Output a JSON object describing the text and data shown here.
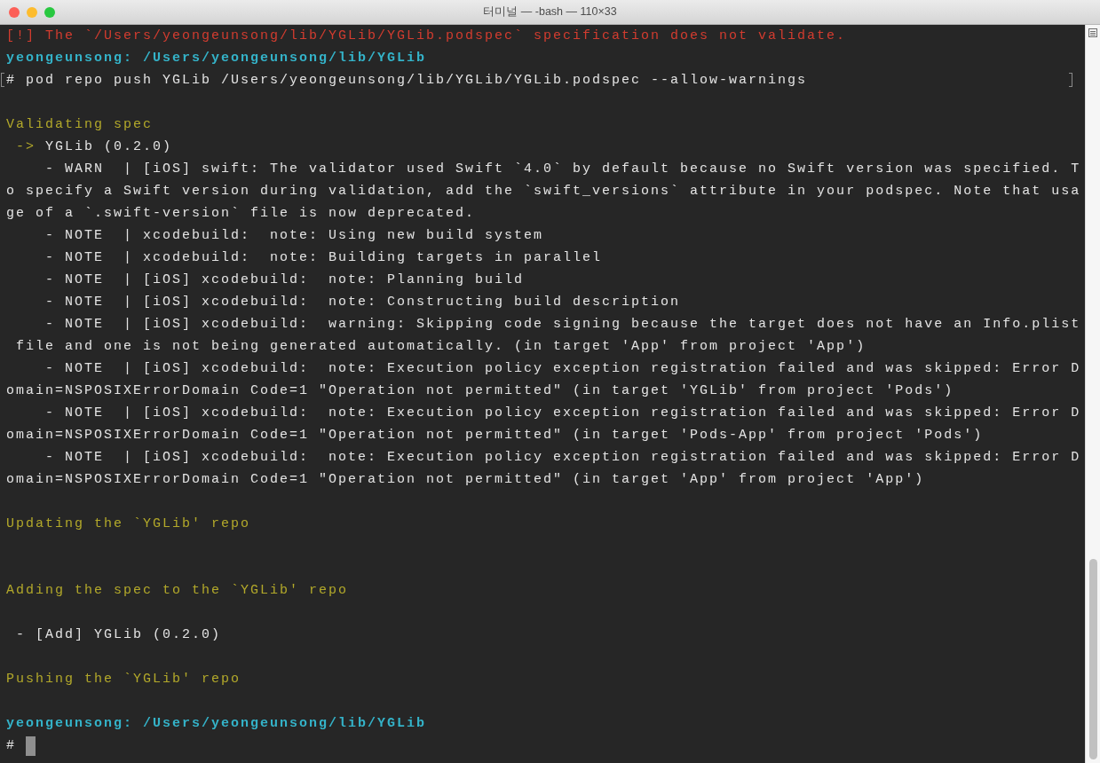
{
  "window": {
    "title": "터미널 — -bash — 110×33"
  },
  "lines": [
    {
      "kind": "error",
      "text": "[!] The `/Users/yeongeunsong/lib/YGLib/YGLib.podspec` specification does not validate."
    },
    {
      "kind": "prompt",
      "text": "yeongeunsong: /Users/yeongeunsong/lib/YGLib"
    },
    {
      "kind": "command",
      "text": "# pod repo push YGLib /Users/yeongeunsong/lib/YGLib/YGLib.podspec --allow-warnings"
    },
    {
      "kind": "blank"
    },
    {
      "kind": "info",
      "text": "Validating spec"
    },
    {
      "kind": "arrow",
      "prefix": " ->",
      "text": " YGLib (0.2.0)"
    },
    {
      "kind": "plain",
      "text": "    - WARN  | [iOS] swift: The validator used Swift `4.0` by default because no Swift version was specified. T"
    },
    {
      "kind": "plain",
      "text": "o specify a Swift version during validation, add the `swift_versions` attribute in your podspec. Note that usa"
    },
    {
      "kind": "plain",
      "text": "ge of a `.swift-version` file is now deprecated."
    },
    {
      "kind": "plain",
      "text": "    - NOTE  | xcodebuild:  note: Using new build system"
    },
    {
      "kind": "plain",
      "text": "    - NOTE  | xcodebuild:  note: Building targets in parallel"
    },
    {
      "kind": "plain",
      "text": "    - NOTE  | [iOS] xcodebuild:  note: Planning build"
    },
    {
      "kind": "plain",
      "text": "    - NOTE  | [iOS] xcodebuild:  note: Constructing build description"
    },
    {
      "kind": "plain",
      "text": "    - NOTE  | [iOS] xcodebuild:  warning: Skipping code signing because the target does not have an Info.plist"
    },
    {
      "kind": "plain",
      "text": " file and one is not being generated automatically. (in target 'App' from project 'App')"
    },
    {
      "kind": "plain",
      "text": "    - NOTE  | [iOS] xcodebuild:  note: Execution policy exception registration failed and was skipped: Error D"
    },
    {
      "kind": "plain",
      "text": "omain=NSPOSIXErrorDomain Code=1 \"Operation not permitted\" (in target 'YGLib' from project 'Pods')"
    },
    {
      "kind": "plain",
      "text": "    - NOTE  | [iOS] xcodebuild:  note: Execution policy exception registration failed and was skipped: Error D"
    },
    {
      "kind": "plain",
      "text": "omain=NSPOSIXErrorDomain Code=1 \"Operation not permitted\" (in target 'Pods-App' from project 'Pods')"
    },
    {
      "kind": "plain",
      "text": "    - NOTE  | [iOS] xcodebuild:  note: Execution policy exception registration failed and was skipped: Error D"
    },
    {
      "kind": "plain",
      "text": "omain=NSPOSIXErrorDomain Code=1 \"Operation not permitted\" (in target 'App' from project 'App')"
    },
    {
      "kind": "blank"
    },
    {
      "kind": "info",
      "text": "Updating the `YGLib' repo"
    },
    {
      "kind": "blank"
    },
    {
      "kind": "blank"
    },
    {
      "kind": "info",
      "text": "Adding the spec to the `YGLib' repo"
    },
    {
      "kind": "blank"
    },
    {
      "kind": "plain",
      "text": " - [Add] YGLib (0.2.0)"
    },
    {
      "kind": "blank"
    },
    {
      "kind": "info",
      "text": "Pushing the `YGLib' repo"
    },
    {
      "kind": "blank"
    },
    {
      "kind": "prompt",
      "text": "yeongeunsong: /Users/yeongeunsong/lib/YGLib"
    },
    {
      "kind": "input",
      "text": "# "
    }
  ]
}
